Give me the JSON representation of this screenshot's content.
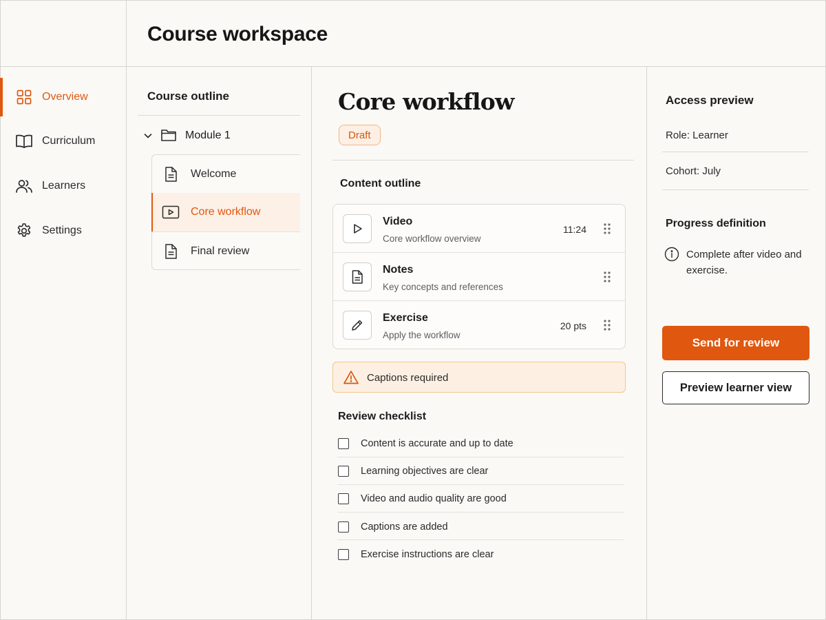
{
  "header": {
    "title": "Course workspace"
  },
  "sidebar": {
    "items": [
      {
        "label": "Overview",
        "icon": "grid-icon",
        "active": true
      },
      {
        "label": "Curriculum",
        "icon": "book-icon"
      },
      {
        "label": "Learners",
        "icon": "users-icon"
      },
      {
        "label": "Settings",
        "icon": "gear-icon"
      }
    ]
  },
  "outline": {
    "title": "Course outline",
    "module": {
      "label": "Module 1",
      "expanded": true
    },
    "lessons": [
      {
        "label": "Welcome",
        "icon": "document-icon"
      },
      {
        "label": "Core workflow",
        "icon": "video-icon",
        "active": true
      },
      {
        "label": "Final review",
        "icon": "document-icon"
      }
    ]
  },
  "main": {
    "title": "Core workflow",
    "status": "Draft",
    "content_title": "Content outline",
    "items": [
      {
        "title": "Video",
        "subtitle": "Core workflow overview",
        "meta": "11:24",
        "icon": "play-icon"
      },
      {
        "title": "Notes",
        "subtitle": "Key concepts and references",
        "meta": "",
        "icon": "notes-icon"
      },
      {
        "title": "Exercise",
        "subtitle": "Apply the workflow",
        "meta": "20 pts",
        "icon": "pencil-icon"
      }
    ],
    "warning": "Captions required",
    "checklist_title": "Review checklist",
    "checklist": [
      "Content is accurate and up to date",
      "Learning objectives are clear",
      "Video and audio quality are good",
      "Captions are added",
      "Exercise instructions are clear"
    ]
  },
  "panel": {
    "access_title": "Access preview",
    "role": "Role: Learner",
    "cohort": "Cohort: July",
    "progress_title": "Progress definition",
    "progress_note": "Complete after video and exercise.",
    "primary_button": "Send for review",
    "secondary_button": "Preview learner view"
  },
  "colors": {
    "accent": "#e0570f",
    "accent_soft": "#fdf0e6",
    "warning_bg": "#fdf0e2",
    "border": "#d6d4cf",
    "background": "#faf9f6"
  }
}
